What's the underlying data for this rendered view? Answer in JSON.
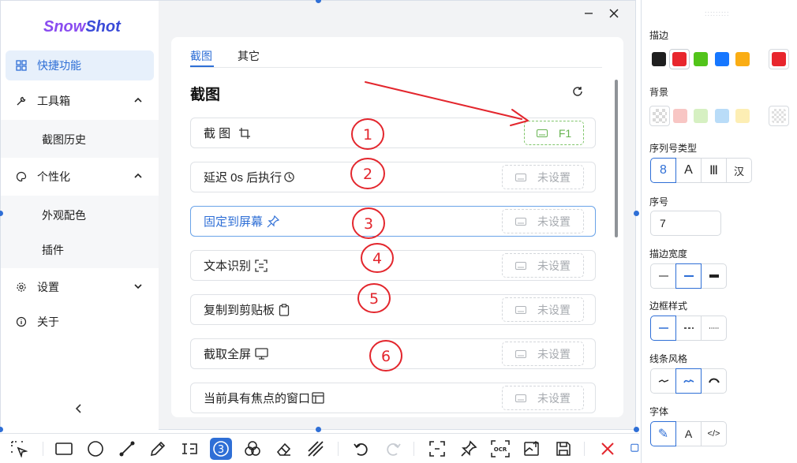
{
  "app": {
    "logo_part1": "Snow",
    "logo_part2": "Shot"
  },
  "sidebar": {
    "items": [
      {
        "label": "快捷功能",
        "active": true
      },
      {
        "label": "工具箱"
      },
      {
        "label": "截图历史"
      },
      {
        "label": "个性化"
      },
      {
        "label": "外观配色"
      },
      {
        "label": "插件"
      },
      {
        "label": "设置"
      },
      {
        "label": "关于"
      }
    ]
  },
  "tabs": [
    {
      "label": "截图",
      "active": true
    },
    {
      "label": "其它"
    }
  ],
  "section_title": "截图",
  "shortcuts": [
    {
      "label": "截 图",
      "icon": "crop-icon",
      "key": "F1"
    },
    {
      "label": "延迟 0s 后执行",
      "icon": "clock-icon",
      "key": "未设置"
    },
    {
      "label": "固定到屏幕",
      "icon": "pin-icon",
      "key": "未设置"
    },
    {
      "label": "文本识别",
      "icon": "scan-text-icon",
      "key": "未设置"
    },
    {
      "label": "复制到剪贴板",
      "icon": "clipboard-icon",
      "key": "未设置"
    },
    {
      "label": "截取全屏",
      "icon": "monitor-icon",
      "key": "未设置"
    },
    {
      "label": "当前具有焦点的窗口",
      "icon": "window-icon",
      "key": "未设置"
    }
  ],
  "annotations": [
    "1",
    "2",
    "3",
    "4",
    "5",
    "6"
  ],
  "props": {
    "stroke_label": "描边",
    "stroke_colors": [
      "#1f1f1f",
      "#e8262d",
      "#52c41a",
      "#1677ff",
      "#faad14"
    ],
    "stroke_selected": "#e8262d",
    "bg_label": "背景",
    "bg_colors": [
      "transparent",
      "#f8c6c4",
      "#d6f0c2",
      "#b9dcf8",
      "#fdeeb4"
    ],
    "serial_type_label": "序列号类型",
    "serial_types": [
      "8",
      "A",
      "Ⅲ",
      "汉"
    ],
    "serial_label": "序号",
    "serial_value": "7",
    "stroke_width_label": "描边宽度",
    "border_style_label": "边框样式",
    "line_style_label": "线条风格",
    "font_label": "字体",
    "font_options": [
      "✎",
      "A",
      "</>"
    ]
  },
  "colors": {
    "accent": "#2f6fd6",
    "annotation_red": "#e3262d",
    "set_key_green": "#67b451"
  }
}
